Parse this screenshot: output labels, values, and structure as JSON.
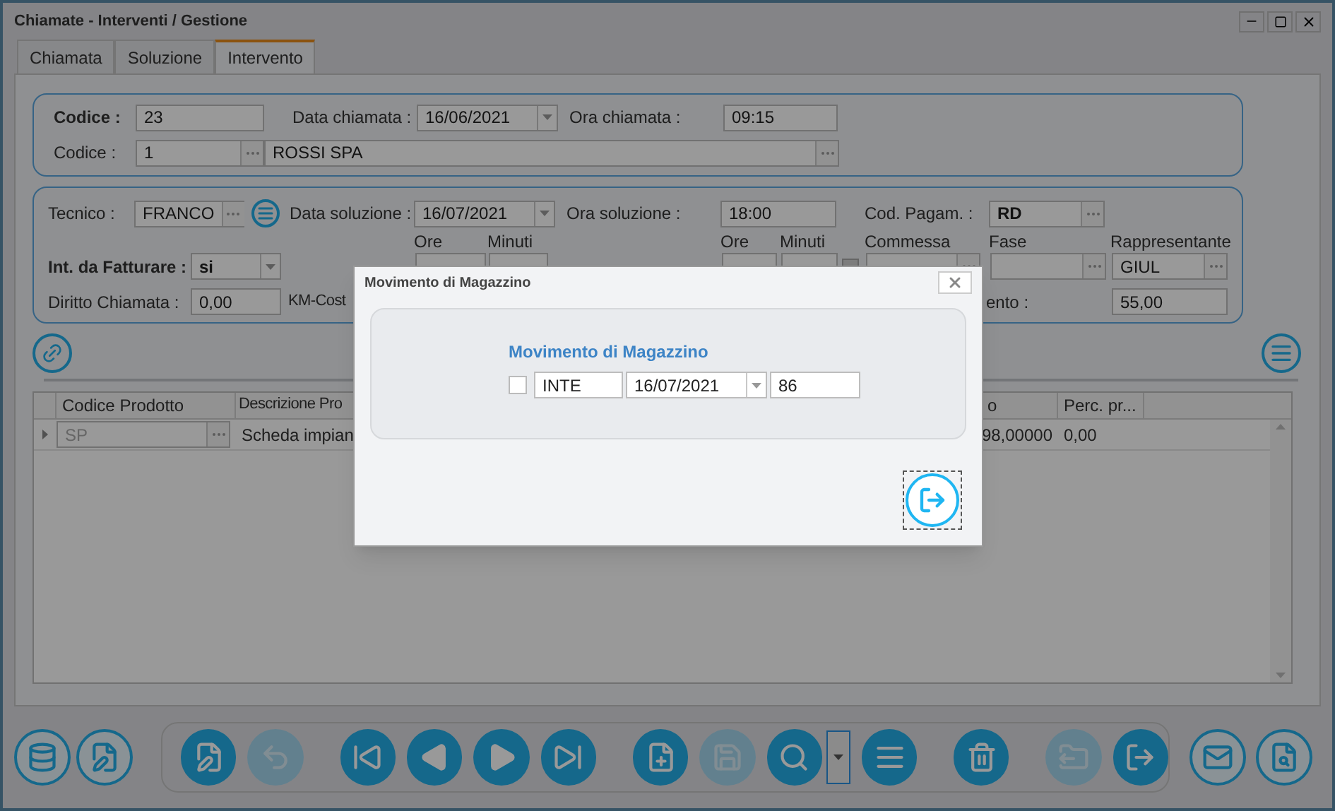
{
  "window": {
    "title": "Chiamate - Interventi / Gestione"
  },
  "tabs": [
    {
      "label": "Chiamata",
      "selected": false
    },
    {
      "label": "Soluzione",
      "selected": false
    },
    {
      "label": "Intervento",
      "selected": true
    }
  ],
  "header": {
    "codice_label": "Codice :",
    "codice": "23",
    "data_chiamata_label": "Data chiamata :",
    "data_chiamata": "16/06/2021",
    "ora_chiamata_label": "Ora chiamata :",
    "ora_chiamata": "09:15",
    "cliente_label": "Codice :",
    "cliente_codice": "1",
    "cliente_nome": "ROSSI SPA"
  },
  "soluzione": {
    "tecnico_label": "Tecnico :",
    "tecnico": "FRANCO",
    "data_label": "Data soluzione :",
    "data": "16/07/2021",
    "ora_label": "Ora soluzione :",
    "ora": "18:00",
    "pagam_label": "Cod. Pagam. :",
    "pagam": "RD",
    "col_headers": [
      "Ore",
      "Minuti",
      "Ore",
      "Minuti",
      "Commessa",
      "Fase",
      "Rappresentante"
    ],
    "fatturare_label": "Int. da Fatturare :",
    "fatturare": "si",
    "rappresentante": "GIUL",
    "diritto_label": "Diritto Chiamata :",
    "diritto": "0,00",
    "km_label": "KM-Cost",
    "cut_label": "ento :",
    "cut_value": "55,00"
  },
  "grid": {
    "columns": [
      "Codice Prodotto",
      "Descrizione Pro",
      "o",
      "Perc. pr..."
    ],
    "rows": [
      {
        "cells": [
          "SP",
          "Scheda impian",
          "98,00000",
          "0,00"
        ]
      }
    ]
  },
  "toolbar": [
    {
      "kind": "outlined",
      "disabled": false
    },
    {
      "kind": "outlined",
      "disabled": false
    },
    {
      "kind": "filled",
      "disabled": false
    },
    {
      "kind": "filled",
      "disabled": true
    },
    {
      "kind": "filled",
      "disabled": false
    },
    {
      "kind": "filled",
      "disabled": false
    },
    {
      "kind": "filled",
      "disabled": false
    },
    {
      "kind": "filled",
      "disabled": false
    },
    {
      "kind": "filled",
      "disabled": false
    },
    {
      "kind": "filled",
      "disabled": true
    },
    {
      "kind": "filled",
      "disabled": false
    },
    {
      "kind": "dropdown",
      "disabled": false
    },
    {
      "kind": "filled",
      "disabled": false
    },
    {
      "kind": "filled",
      "disabled": false
    },
    {
      "kind": "filled",
      "disabled": true
    },
    {
      "kind": "filled",
      "disabled": false
    },
    {
      "kind": "outlined",
      "disabled": false
    },
    {
      "kind": "outlined",
      "disabled": false
    }
  ],
  "dialog": {
    "title": "Movimento di Magazzino",
    "heading": "Movimento di Magazzino",
    "checked": false,
    "causale": "INTE",
    "data": "16/07/2021",
    "numero": "86"
  }
}
